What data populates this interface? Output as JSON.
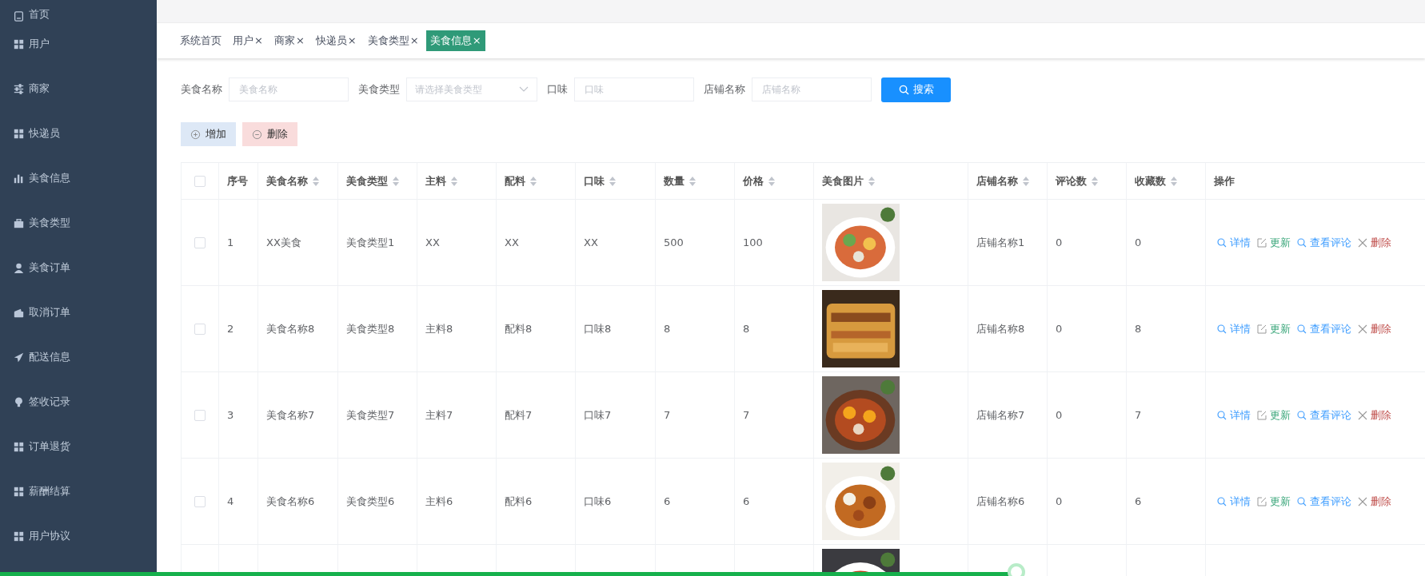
{
  "sidebar": {
    "items": [
      {
        "label": "首页",
        "kind": "tablet",
        "selected": false
      },
      {
        "label": "用户",
        "kind": "grid",
        "selected": false
      },
      {
        "label": "商家",
        "kind": "sliders",
        "selected": false
      },
      {
        "label": "快递员",
        "kind": "grid",
        "selected": false
      },
      {
        "label": "美食信息",
        "kind": "chart",
        "selected": false
      },
      {
        "label": "美食类型",
        "kind": "case",
        "selected": false
      },
      {
        "label": "美食订单",
        "kind": "person",
        "selected": false
      },
      {
        "label": "取消订单",
        "kind": "wallet",
        "selected": false
      },
      {
        "label": "配送信息",
        "kind": "plane",
        "selected": false
      },
      {
        "label": "签收记录",
        "kind": "bulb",
        "selected": false
      },
      {
        "label": "订单退货",
        "kind": "grid",
        "selected": false
      },
      {
        "label": "薪酬结算",
        "kind": "grid",
        "selected": false
      },
      {
        "label": "用户协议",
        "kind": "grid",
        "selected": false
      }
    ]
  },
  "tabs": [
    {
      "label": "系统首页",
      "selected": false
    },
    {
      "label": "用户",
      "close": "×",
      "selected": false
    },
    {
      "label": "商家",
      "close": "×",
      "selected": false
    },
    {
      "label": "快递员",
      "close": "×",
      "selected": false
    },
    {
      "label": "美食类型",
      "close": "×",
      "selected": false
    },
    {
      "label": "美食信息",
      "close": "×",
      "selected": true
    }
  ],
  "search": {
    "fields": [
      {
        "label": "美食名称",
        "placeholder": "美食名称",
        "kind": "input"
      },
      {
        "label": "美食类型",
        "placeholder": "请选择美食类型",
        "kind": "select"
      },
      {
        "label": "口味",
        "placeholder": "口味",
        "kind": "input"
      },
      {
        "label": "店铺名称",
        "placeholder": "店铺名称",
        "kind": "input"
      }
    ],
    "button": "搜索"
  },
  "actions": [
    {
      "label": "增加",
      "kind": "add"
    },
    {
      "label": "删除",
      "kind": "remove"
    }
  ],
  "table": {
    "all_checked": false,
    "columns": [
      {
        "label": "序号",
        "sortable": false
      },
      {
        "label": "美食名称",
        "sortable": true
      },
      {
        "label": "美食类型",
        "sortable": true
      },
      {
        "label": "主料",
        "sortable": true
      },
      {
        "label": "配料",
        "sortable": true
      },
      {
        "label": "口味",
        "sortable": true
      },
      {
        "label": "数量",
        "sortable": true
      },
      {
        "label": "价格",
        "sortable": true
      },
      {
        "label": "美食图片",
        "sortable": true
      },
      {
        "label": "店铺名称",
        "sortable": true
      },
      {
        "label": "评论数",
        "sortable": true
      },
      {
        "label": "收藏数",
        "sortable": true
      },
      {
        "label": "操作",
        "sortable": false
      }
    ],
    "rows": [
      {
        "checked": false,
        "cells": [
          "1",
          "XX美食",
          "美食类型1",
          "XX",
          "XX",
          "XX",
          "500",
          "100"
        ],
        "image": {
          "kind": "picture"
        },
        "cells_after": [
          "店铺名称1",
          "0",
          "0"
        ],
        "actions": [
          {
            "label": "详情",
            "kind": "view"
          },
          {
            "label": "更新",
            "kind": "edit"
          },
          {
            "label": "查看评论",
            "kind": "view"
          },
          {
            "label": "删除",
            "kind": "delete"
          }
        ]
      },
      {
        "checked": false,
        "cells": [
          "2",
          "美食名称8",
          "美食类型8",
          "主料8",
          "配料8",
          "口味8",
          "8",
          "8"
        ],
        "image": {
          "kind": "picture"
        },
        "cells_after": [
          "店铺名称8",
          "0",
          "8"
        ],
        "actions": [
          {
            "label": "详情",
            "kind": "view"
          },
          {
            "label": "更新",
            "kind": "edit"
          },
          {
            "label": "查看评论",
            "kind": "view"
          },
          {
            "label": "删除",
            "kind": "delete"
          }
        ]
      },
      {
        "checked": false,
        "cells": [
          "3",
          "美食名称7",
          "美食类型7",
          "主料7",
          "配料7",
          "口味7",
          "7",
          "7"
        ],
        "image": {
          "kind": "picture"
        },
        "cells_after": [
          "店铺名称7",
          "0",
          "7"
        ],
        "actions": [
          {
            "label": "详情",
            "kind": "view"
          },
          {
            "label": "更新",
            "kind": "edit"
          },
          {
            "label": "查看评论",
            "kind": "view"
          },
          {
            "label": "删除",
            "kind": "delete"
          }
        ]
      },
      {
        "checked": false,
        "cells": [
          "4",
          "美食名称6",
          "美食类型6",
          "主料6",
          "配料6",
          "口味6",
          "6",
          "6"
        ],
        "image": {
          "kind": "picture"
        },
        "cells_after": [
          "店铺名称6",
          "0",
          "6"
        ],
        "actions": [
          {
            "label": "详情",
            "kind": "view"
          },
          {
            "label": "更新",
            "kind": "edit"
          },
          {
            "label": "查看评论",
            "kind": "view"
          },
          {
            "label": "删除",
            "kind": "delete"
          }
        ]
      },
      {
        "cells": [],
        "image": {
          "kind": "picture"
        },
        "cells_after": [],
        "actions": []
      }
    ]
  },
  "playback": {
    "level": 0.713
  }
}
